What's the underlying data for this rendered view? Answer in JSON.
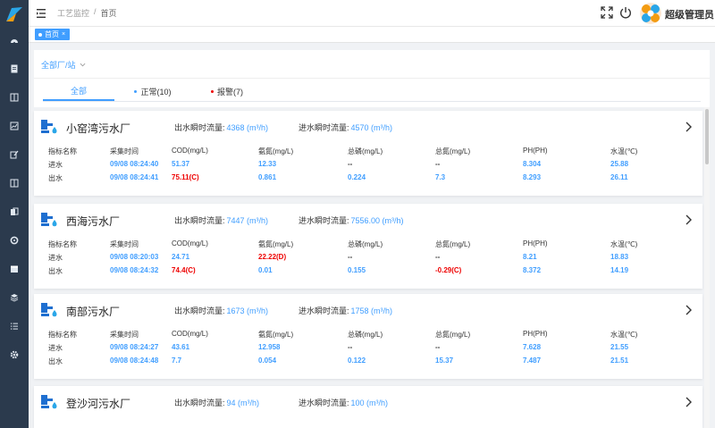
{
  "header": {
    "breadcrumb": [
      "工艺监控",
      "/",
      "首页"
    ],
    "username": "超级管理员"
  },
  "tagbar": {
    "tag_label": "首页",
    "tag_close": "×"
  },
  "filter": {
    "label": "全部厂/站"
  },
  "tabs": [
    {
      "label": "全部"
    },
    {
      "label": "正常(10)",
      "dot_color": "#409eff"
    },
    {
      "label": "报警(7)",
      "dot_color": "#e00000"
    }
  ],
  "flow_labels": {
    "out": "出水瞬时流量:",
    "in": "进水瞬时流量:"
  },
  "table_headers": [
    "指标名称",
    "采集时间",
    "COD(mg/L)",
    "氨氮(mg/L)",
    "总磷(mg/L)",
    "总氮(mg/L)",
    "PH(PH)",
    "水温(℃)"
  ],
  "plants": [
    {
      "name": "小窑湾污水厂",
      "out_flow": "4368 (m³/h)",
      "in_flow": "4570 (m³/h)",
      "rows": [
        [
          "进水",
          "09/08 08:24:40",
          "51.37",
          "12.33",
          "--",
          "--",
          "8.304",
          "25.88"
        ],
        [
          "出水",
          "09/08 08:24:41",
          "75.11(C)",
          "0.861",
          "0.224",
          "7.3",
          "8.293",
          "26.11"
        ]
      ]
    },
    {
      "name": "西海污水厂",
      "out_flow": "7447 (m³/h)",
      "in_flow": "7556.00 (m³/h)",
      "rows": [
        [
          "进水",
          "09/08 08:20:03",
          "24.71",
          "22.22(D)",
          "--",
          "--",
          "8.21",
          "18.83"
        ],
        [
          "出水",
          "09/08 08:24:32",
          "74.4(C)",
          "0.01",
          "0.155",
          "-0.29(C)",
          "8.372",
          "14.19"
        ]
      ]
    },
    {
      "name": "南部污水厂",
      "out_flow": "1673 (m³/h)",
      "in_flow": "1758 (m³/h)",
      "rows": [
        [
          "进水",
          "09/08 08:24:27",
          "43.61",
          "12.958",
          "--",
          "--",
          "7.628",
          "21.55"
        ],
        [
          "出水",
          "09/08 08:24:48",
          "7.7",
          "0.054",
          "0.122",
          "15.37",
          "7.487",
          "21.51"
        ]
      ]
    },
    {
      "name": "登沙河污水厂",
      "out_flow": "94 (m³/h)",
      "in_flow": "100 (m³/h)",
      "rows": []
    }
  ],
  "colors": {
    "accent": "#409eff",
    "alarm": "#e00000",
    "sidebar": "#2b3a4d"
  },
  "icons": {
    "sidebar": [
      "dashboard-icon",
      "document-icon",
      "panel-icon",
      "chart-icon",
      "edit-icon",
      "panel-icon",
      "copy-icon",
      "settings-cog-icon",
      "calendar-icon",
      "layers-icon",
      "list-icon",
      "gear-icon"
    ],
    "header": [
      "hamburger-icon",
      "fullscreen-icon",
      "power-icon"
    ],
    "card": [
      "water-plant-icon",
      "chevron-right-icon"
    ]
  }
}
